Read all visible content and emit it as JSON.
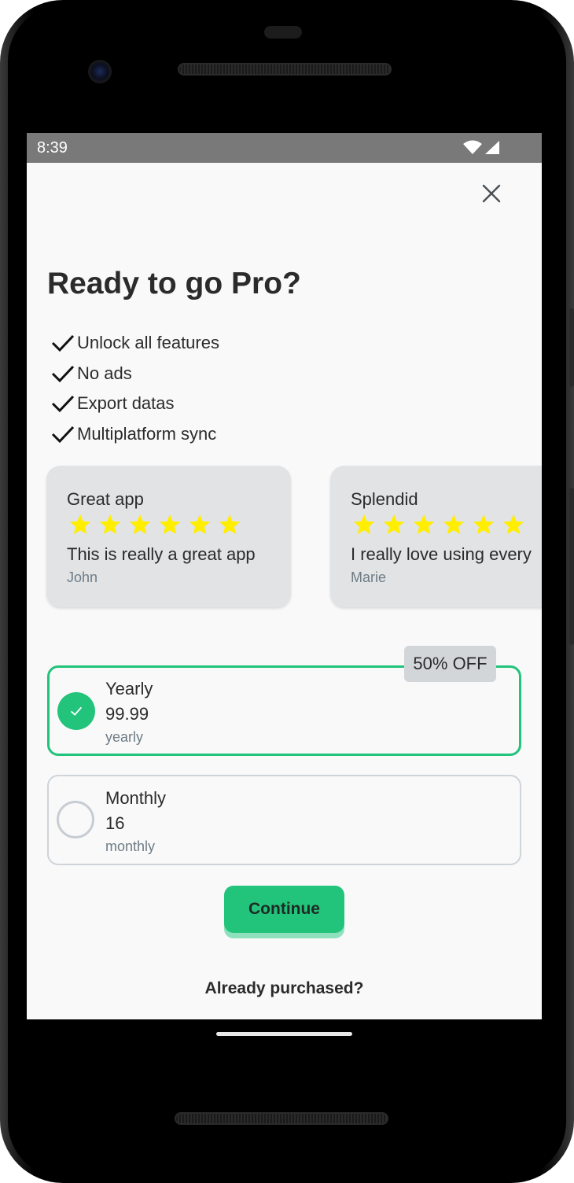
{
  "status_bar": {
    "time": "8:39",
    "icons": [
      "wifi-icon",
      "signal-icon"
    ]
  },
  "paywall": {
    "title": "Ready to go Pro?",
    "close_icon": "close-icon",
    "features": [
      {
        "label": "Unlock all features",
        "icon": "check-icon"
      },
      {
        "label": "No ads",
        "icon": "check-icon"
      },
      {
        "label": "Export datas",
        "icon": "check-icon"
      },
      {
        "label": "Multiplatform sync",
        "icon": "check-icon"
      }
    ],
    "reviews": [
      {
        "title": "Great app",
        "rating": 6,
        "body": "This is really a great app",
        "author": "John"
      },
      {
        "title": "Splendid",
        "rating": 6,
        "body": "I really love using every",
        "author": "Marie"
      }
    ],
    "plans": [
      {
        "name": "Yearly",
        "price": "99.99",
        "period": "yearly",
        "selected": true,
        "badge": "50% OFF"
      },
      {
        "name": "Monthly",
        "price": "16",
        "period": "monthly",
        "selected": false
      }
    ],
    "continue_label": "Continue",
    "already_purchased_label": "Already purchased?"
  },
  "colors": {
    "accent": "#22c37b",
    "star": "#ffee00",
    "card": "#e1e3e5",
    "text": "#2b2b2b",
    "muted": "#6e7c85"
  }
}
